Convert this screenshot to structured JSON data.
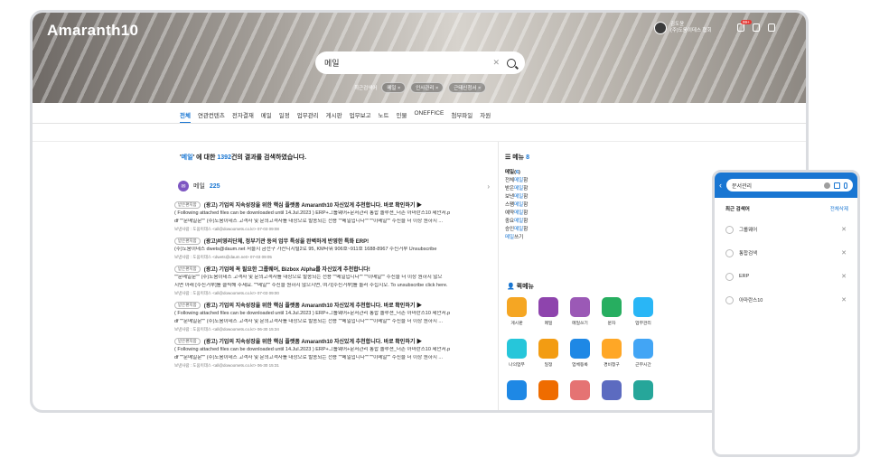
{
  "app": {
    "logo": "Amaranth10"
  },
  "header": {
    "user_name": "김도윤",
    "user_org": "(주)도움이데스 협회",
    "notification_count": "99+",
    "icons": [
      "bell-icon",
      "doc-icon",
      "download-icon",
      "more-icon"
    ]
  },
  "search": {
    "value": "메일",
    "recent_label": "최근검색어",
    "recent_chips": [
      "메일 ×",
      "인사관리 ×",
      "근태신청서 ×"
    ]
  },
  "tabs": [
    "전체",
    "연관컨텐츠",
    "전자결재",
    "메일",
    "일정",
    "업무관리",
    "게시판",
    "업무보고",
    "노트",
    "인물",
    "ONEFFICE",
    "첨부파일",
    "자원"
  ],
  "summary": {
    "open_quote": "'",
    "query": "메일",
    "mid": "' 에 대한 ",
    "count": "1392",
    "tail": "건의 결과를 검색하였습니다."
  },
  "mail_section": {
    "title": "메일",
    "count": "225"
  },
  "mails": [
    {
      "tag": "받은편지함",
      "subject": "(광고) 기업의 지속성장을 위한 핵심 플랫폼 Amaranth10 자신있게 추천합니다. 바로 확인하기 ▶",
      "body1": "( Following attached files can be downloaded until 14.Jul.2023 ) ERP+그룹웨어+문서관리 통합 솔루션_더존 아마란스10 제안서.p",
      "body2": "df \"\"문메일문\"\" (주)도움이데스 고객사 및 문의고객사를 대상으로 발송되는 전용 \"\"메일입니다\"\" \"\"이메일\"\" 수신을 더 이상 원하지 ...",
      "meta": "보낸사람 : 도움이데스 <all@dowoomets.co.kr>    07-03 09:08"
    },
    {
      "tag": "받은편지함",
      "subject": "(광고)비영리단체, 정부기관 등의 업무 특성을 완벽하게 반영한 특화 ERP!",
      "body1": "(주)도움이데스 dwets@daum.net 서울시 금천구 가산디지털2로 95, KM타워 906호~911호 1688-8967 수신거부 Unsubscribe",
      "body2": "",
      "meta": "보낸사람 : 도움이데스 <dwets@daum.net>    07-03 09:05"
    },
    {
      "tag": "받은편지함",
      "subject": "(광고) 기업에 꼭 필요한 그룹웨어, Bizbox Alpha를 자신있게 추천합니다!",
      "body1": "\"\"문메일문\"\" (주)도움이데스 고객사 및 문의고객사를 대상으로 발송되는 전용 \"\"메일입니다\"\" \"\"이메일\"\" 수신을 더 이상 원하지 않으",
      "body2": "시면 아래 [수신거부]를 클릭해 주세요. \"\"메일\"\" 수신을 원하지 않으시면, 여기[수신거부]를 눌러 주십시오. To unsubscribe click here.",
      "meta": "보낸사람 : 도움이데스 <all@dowoomets.co.kr>    07-03 09:00"
    },
    {
      "tag": "받은편지함",
      "subject": "(광고) 기업의 지속성장을 위한 핵심 플랫폼 Amaranth10 자신있게 추천합니다. 바로 확인하기 ▶",
      "body1": "( Following attached files can be downloaded until 14.Jul.2023 ) ERP+그룹웨어+문서관리 통합 솔루션_더존 아마란스10 제안서.p",
      "body2": "df \"\"문메일문\"\" (주)도움이데스 고객사 및 문의고객사를 대상으로 발송되는 전용 \"\"메일입니다\"\" \"\"이메일\"\" 수신을 더 이상 원하지 ...",
      "meta": "보낸사람 : 도움이데스 <all@dowoomets.co.kr>    06-30 15:34"
    },
    {
      "tag": "받은편지함",
      "subject": "(광고) 기업의 지속성장을 위한 핵심 플랫폼 Amaranth10 자신있게 추천합니다. 바로 확인하기 ▶",
      "body1": "( Following attached files can be downloaded until 14.Jul.2023 ) ERP+그룹웨어+문서관리 통합 솔루션_더존 아마란스10 제안서.p",
      "body2": "df \"\"문메일문\"\" (주)도움이데스 고객사 및 문의고객사를 대상으로 발송되는 전용 \"\"메일입니다\"\" \"\"이메일\"\" 수신을 더 이상 원하지 ...",
      "meta": "보낸사람 : 도움이데스 <all@dowoomets.co.kr>    06-30 15:31"
    }
  ],
  "side": {
    "menu_title": "메뉴",
    "menu_count": "8",
    "menu_items": [
      {
        "pre": "메일(",
        "hl": "6",
        "post": ")"
      },
      {
        "pre": "전체",
        "hl": "메일",
        "post": "함"
      },
      {
        "pre": "받은",
        "hl": "메일",
        "post": "함"
      },
      {
        "pre": "보낸",
        "hl": "메일",
        "post": "함"
      },
      {
        "pre": "스팸",
        "hl": "메일",
        "post": "함"
      },
      {
        "pre": "예약",
        "hl": "메일",
        "post": "함"
      },
      {
        "pre": "중요",
        "hl": "메일",
        "post": "함"
      },
      {
        "pre": "승인",
        "hl": "메일",
        "post": "함"
      },
      {
        "pre": "",
        "hl": "메일",
        "post": "쓰기"
      }
    ],
    "quick_title": "퀵메뉴",
    "apps": [
      {
        "label": "게시판",
        "color": "#f5a623"
      },
      {
        "label": "메일",
        "color": "#8e44ad"
      },
      {
        "label": "메일쓰기",
        "color": "#9b59b6"
      },
      {
        "label": "문자",
        "color": "#27ae60"
      },
      {
        "label": "업무관리",
        "color": "#29b6f6"
      },
      {
        "label": "나의업무",
        "color": "#26c6da"
      },
      {
        "label": "일정",
        "color": "#f39c12"
      },
      {
        "label": "업체등록",
        "color": "#1e88e5"
      },
      {
        "label": "경비청구",
        "color": "#ffa726"
      },
      {
        "label": "근무시간",
        "color": "#42a5f5"
      },
      {
        "label": "",
        "color": "#1e88e5"
      },
      {
        "label": "",
        "color": "#ef6c00"
      },
      {
        "label": "",
        "color": "#e57373"
      },
      {
        "label": "",
        "color": "#5c6bc0"
      },
      {
        "label": "",
        "color": "#26a69a"
      }
    ]
  },
  "phone": {
    "search_value": "문서관리",
    "recent_title": "최근 검색어",
    "clear_all": "전체삭제",
    "recent_items": [
      "그룹웨어",
      "통합검색",
      "ERP",
      "아마란스10"
    ]
  }
}
